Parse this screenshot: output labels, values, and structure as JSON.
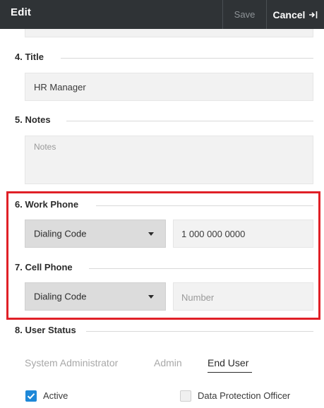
{
  "header": {
    "title": "Edit",
    "save_label": "Save",
    "cancel_label": "Cancel"
  },
  "fields": {
    "title": {
      "heading": "4. Title",
      "value": "HR Manager"
    },
    "notes": {
      "heading": "5. Notes",
      "placeholder": "Notes"
    },
    "work_phone": {
      "heading": "6. Work Phone",
      "dialing_code": "Dialing Code",
      "number": "1 000 000 0000"
    },
    "cell_phone": {
      "heading": "7. Cell Phone",
      "dialing_code": "Dialing Code",
      "number_placeholder": "Number"
    },
    "user_status": {
      "heading": "8. User Status",
      "roles": [
        "System Administrator",
        "Admin",
        "End User"
      ],
      "selected_role": "End User"
    }
  },
  "checkboxes": {
    "active": {
      "label": "Active",
      "checked": true
    },
    "dpo": {
      "label": "Data Protection Officer",
      "checked": false
    }
  },
  "colors": {
    "header_bg": "#2f3336",
    "highlight": "#e02027",
    "checkbox_accent": "#1e88d8"
  }
}
